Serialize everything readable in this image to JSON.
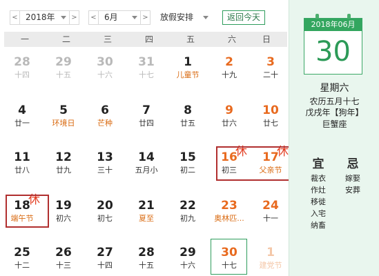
{
  "toolbar": {
    "prev_year": "<",
    "year": "2018年",
    "next_year": ">",
    "prev_month": "<",
    "month": "6月",
    "next_month": ">",
    "holiday_select": "放假安排",
    "today_button": "返回今天"
  },
  "weekdays": [
    "一",
    "二",
    "三",
    "四",
    "五",
    "六",
    "日"
  ],
  "weeks": [
    [
      {
        "num": "28",
        "sub": "十四",
        "other": true
      },
      {
        "num": "29",
        "sub": "十五",
        "other": true
      },
      {
        "num": "30",
        "sub": "十六",
        "other": true
      },
      {
        "num": "31",
        "sub": "十七",
        "other": true
      },
      {
        "num": "1",
        "sub": "儿童节",
        "festival": true
      },
      {
        "num": "2",
        "sub": "十九",
        "weekend": true
      },
      {
        "num": "3",
        "sub": "二十",
        "weekend": true
      }
    ],
    [
      {
        "num": "4",
        "sub": "廿一"
      },
      {
        "num": "5",
        "sub": "环境日",
        "festival": true
      },
      {
        "num": "6",
        "sub": "芒种",
        "festival": true
      },
      {
        "num": "7",
        "sub": "廿四"
      },
      {
        "num": "8",
        "sub": "廿五"
      },
      {
        "num": "9",
        "sub": "廿六",
        "weekend": true
      },
      {
        "num": "10",
        "sub": "廿七",
        "weekend": true
      }
    ],
    [
      {
        "num": "11",
        "sub": "廿八"
      },
      {
        "num": "12",
        "sub": "廿九"
      },
      {
        "num": "13",
        "sub": "三十"
      },
      {
        "num": "14",
        "sub": "五月小"
      },
      {
        "num": "15",
        "sub": "初二"
      },
      {
        "num": "16",
        "sub": "初三",
        "weekend": true,
        "rest": "休"
      },
      {
        "num": "17",
        "sub": "父亲节",
        "weekend": true,
        "festival": true,
        "rest": "休"
      }
    ],
    [
      {
        "num": "18",
        "sub": "端午节",
        "festival": true,
        "rest": "休"
      },
      {
        "num": "19",
        "sub": "初六"
      },
      {
        "num": "20",
        "sub": "初七"
      },
      {
        "num": "21",
        "sub": "夏至",
        "festival": true
      },
      {
        "num": "22",
        "sub": "初九"
      },
      {
        "num": "23",
        "sub": "奥林匹...",
        "weekend": true,
        "festival": true
      },
      {
        "num": "24",
        "sub": "十一",
        "weekend": true
      }
    ],
    [
      {
        "num": "25",
        "sub": "十二"
      },
      {
        "num": "26",
        "sub": "十三"
      },
      {
        "num": "27",
        "sub": "十四"
      },
      {
        "num": "28",
        "sub": "十五"
      },
      {
        "num": "29",
        "sub": "十六"
      },
      {
        "num": "30",
        "sub": "十七",
        "weekend": true,
        "today": true
      },
      {
        "num": "1",
        "sub": "建党节",
        "other": true,
        "weekend": true,
        "festival": true
      }
    ]
  ],
  "panel": {
    "header": "2018年06月",
    "day": "30",
    "weekday": "星期六",
    "lunar": "农历五月十七",
    "ganzhi": "戊戌年【狗年】",
    "zodiac": "巨蟹座",
    "yi_title": "宜",
    "yi_items": [
      "裁衣",
      "作灶",
      "移徙",
      "入宅",
      "纳畜"
    ],
    "ji_title": "忌",
    "ji_items": [
      "嫁娶",
      "安葬"
    ]
  },
  "colors": {
    "accent_green": "#33a65f",
    "weekend_orange": "#e86a1f",
    "rest_red": "#e23c20",
    "holiday_box": "#b02e2e",
    "panel_bg": "#e9f6ee"
  }
}
